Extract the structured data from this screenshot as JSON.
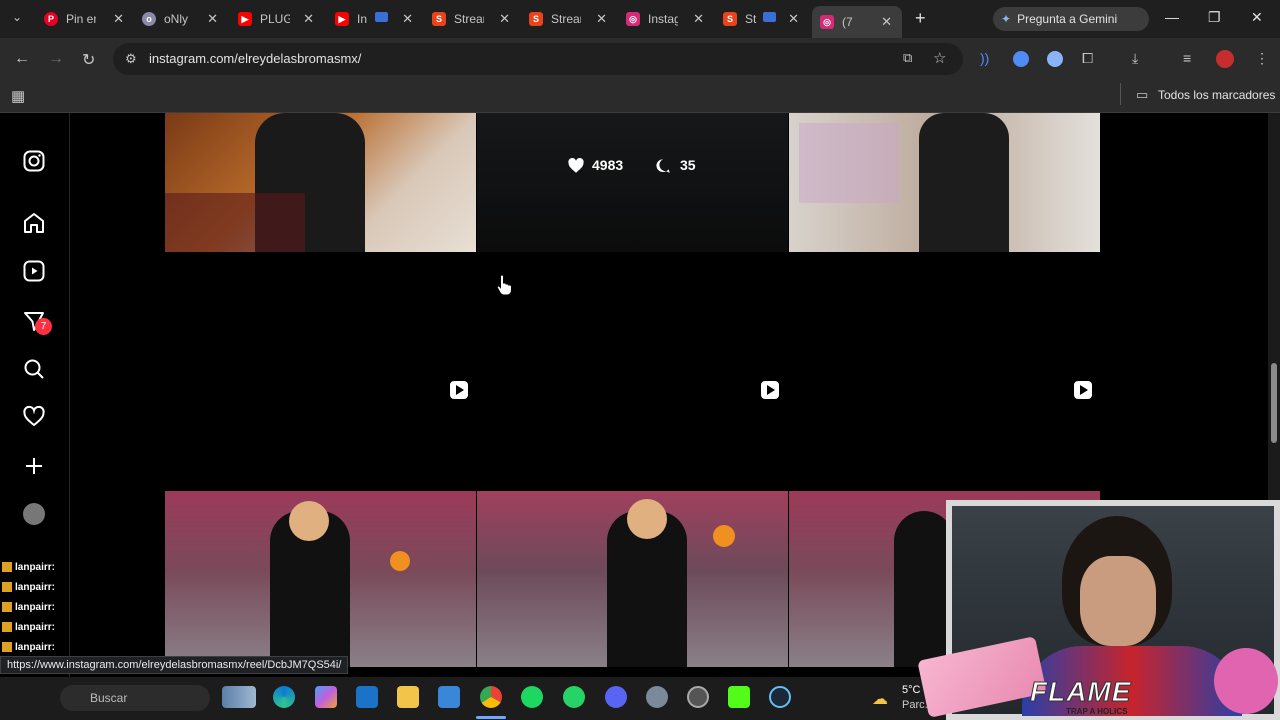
{
  "browser": {
    "tabs": [
      {
        "title": "Pin en",
        "fav_color": "#e60023",
        "fav": "P"
      },
      {
        "title": "oNly",
        "fav_color": "#7a7a9a",
        "fav": "o"
      },
      {
        "title": "PLUG",
        "fav_color": "#ff0000",
        "fav": "▶"
      },
      {
        "title": "In",
        "fav_color": "#ff0000",
        "fav": "▶"
      },
      {
        "title": "Strear",
        "fav_color": "#e8431b",
        "fav": "S"
      },
      {
        "title": "Strear",
        "fav_color": "#e8431b",
        "fav": "S"
      },
      {
        "title": "Instag",
        "fav_color": "#d62976",
        "fav": "◎"
      },
      {
        "title": "St",
        "fav_color": "#e8431b",
        "fav": "S"
      },
      {
        "title": "(7",
        "fav_color": "#d62976",
        "fav": "◎"
      }
    ],
    "new_tab": "+",
    "gemini_label": "Pregunta a Gemini",
    "url": "instagram.com/elreydelasbromasmx/",
    "bookmarks_label": "Todos los marcadores",
    "status_url": "https://www.instagram.com/elreydelasbromasmx/reel/DcbJM7QS54i/"
  },
  "instagram": {
    "notification_count": "7",
    "grid_top_middle": {
      "likes": "4983",
      "comments": "35"
    }
  },
  "taskbar": {
    "search_placeholder": "Buscar",
    "weather_temp": "5°C",
    "weather_desc": "Parc. nub"
  },
  "stream": {
    "chat_user": "lanpairr:",
    "overlay_title": "FLAME",
    "overlay_subtitle": "TRAP A HOLICS"
  },
  "colors": {
    "instagram_red": "#ff3040",
    "browser_bg": "#1f1f1f",
    "toolbar_bg": "#2b2b2b"
  }
}
